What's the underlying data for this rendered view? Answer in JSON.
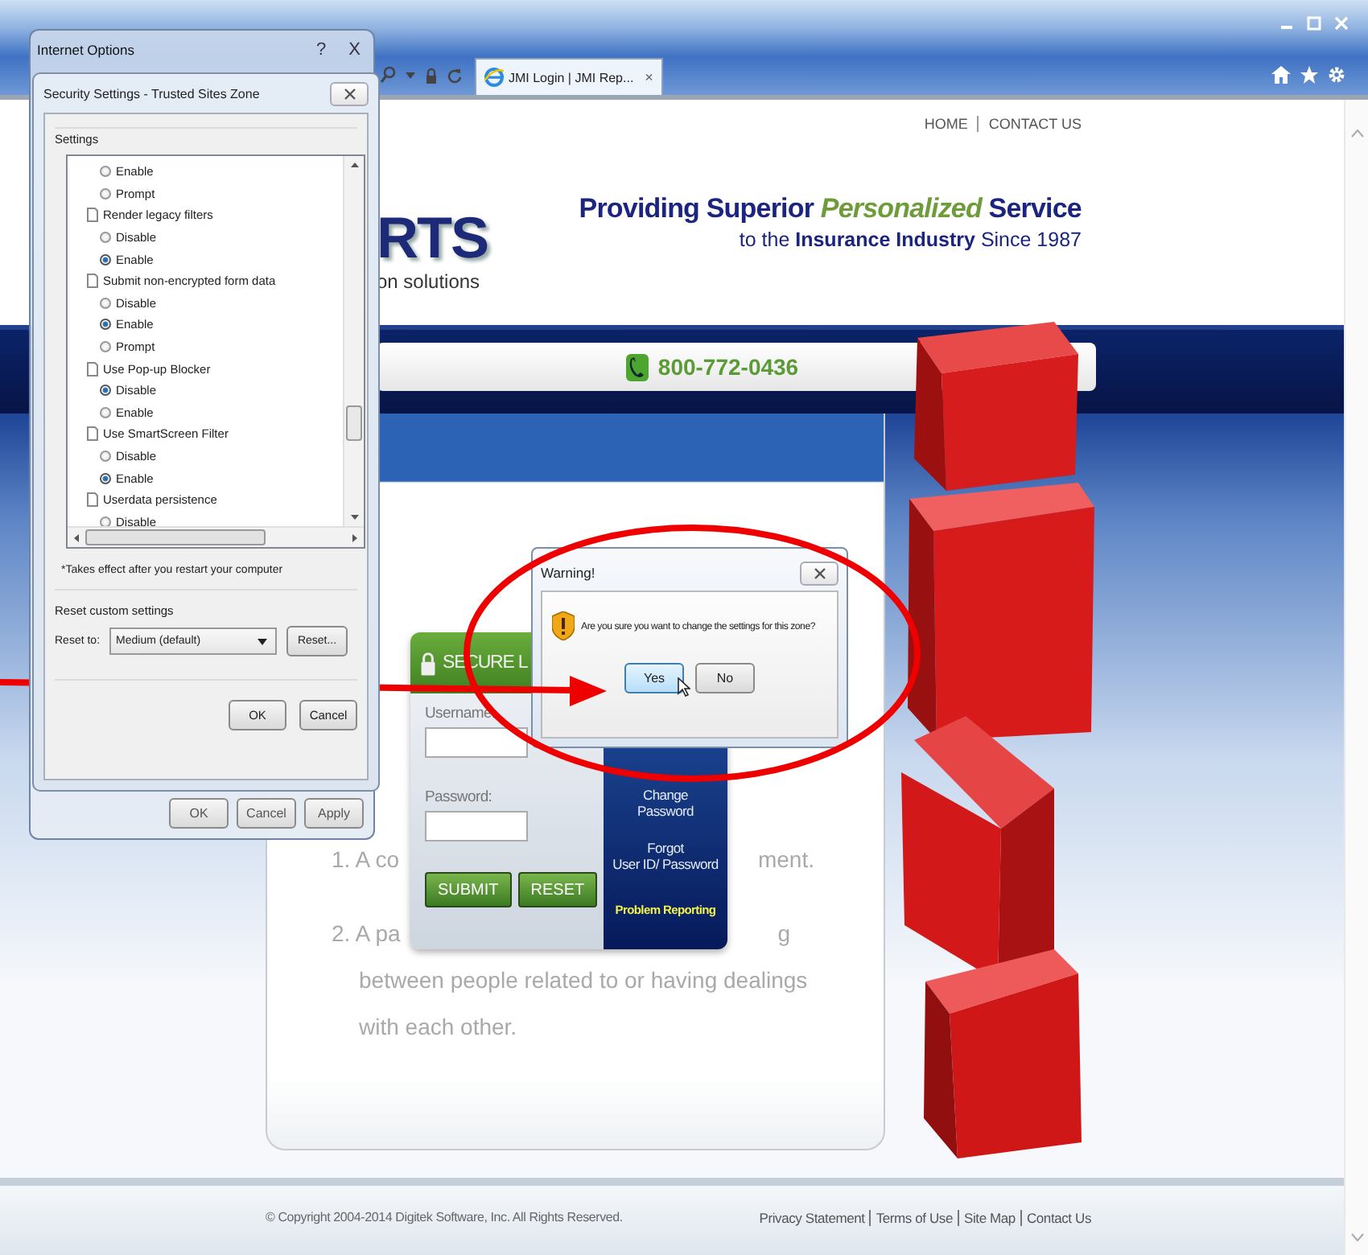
{
  "browser": {
    "tab": {
      "title": "JMI Login | JMI Rep...",
      "close": "×"
    }
  },
  "site": {
    "nav": [
      "HOME",
      "CONTACT US"
    ],
    "logo": [
      "RTS",
      "on solutions"
    ],
    "tagline": [
      "Providing Superior *Personalized* Service",
      "to the **Insurance Industry** Since 1987"
    ],
    "phone": "800-772-0436",
    "faded_text": [
      [
        "1. A co",
        "ment."
      ],
      [
        "2. A pa",
        "g"
      ],
      [
        "between people related to or having dealings"
      ],
      [
        "with each other."
      ]
    ],
    "login": {
      "header": "SECURE L",
      "username_label": "Username:",
      "password_label": "Password:",
      "buttons": [
        "SUBMIT",
        "RESET"
      ],
      "links": [
        {
          "lines": [
            "Change",
            "Password"
          ],
          "highlight": false
        },
        {
          "lines": [
            "Forgot",
            "User ID/ Password"
          ],
          "highlight": false
        },
        {
          "lines": [
            "Problem Reporting"
          ],
          "highlight": true
        }
      ]
    },
    "footer": {
      "copyright": "© Copyright 2004-2014 Digitek Software, Inc. All Rights Reserved.",
      "links": [
        "Privacy Statement",
        "Terms of Use",
        "Site Map",
        "Contact Us"
      ]
    }
  },
  "internet_options": {
    "title": "Internet Options",
    "help": "?",
    "close": "X",
    "buttons": [
      "OK",
      "Cancel",
      "Apply"
    ]
  },
  "security_settings": {
    "title": "Security Settings - Trusted Sites Zone",
    "settings_label": "Settings",
    "items": [
      {
        "kind": "option",
        "label": "Enable",
        "selected": false
      },
      {
        "kind": "option",
        "label": "Prompt",
        "selected": false
      },
      {
        "kind": "group",
        "label": "Render legacy filters"
      },
      {
        "kind": "option",
        "label": "Disable",
        "selected": false
      },
      {
        "kind": "option",
        "label": "Enable",
        "selected": true
      },
      {
        "kind": "group",
        "label": "Submit non-encrypted form data"
      },
      {
        "kind": "option",
        "label": "Disable",
        "selected": false
      },
      {
        "kind": "option",
        "label": "Enable",
        "selected": true
      },
      {
        "kind": "option",
        "label": "Prompt",
        "selected": false
      },
      {
        "kind": "group",
        "label": "Use Pop-up Blocker"
      },
      {
        "kind": "option",
        "label": "Disable",
        "selected": true
      },
      {
        "kind": "option",
        "label": "Enable",
        "selected": false
      },
      {
        "kind": "group",
        "label": "Use SmartScreen Filter"
      },
      {
        "kind": "option",
        "label": "Disable",
        "selected": false
      },
      {
        "kind": "option",
        "label": "Enable",
        "selected": true
      },
      {
        "kind": "group",
        "label": "Userdata persistence"
      },
      {
        "kind": "option",
        "label": "Disable",
        "selected": false
      }
    ],
    "note": "*Takes effect after you restart your computer",
    "reset_group": "Reset custom settings",
    "reset_to": "Reset to:",
    "reset_value": "Medium (default)",
    "reset_button": "Reset...",
    "buttons": [
      "OK",
      "Cancel"
    ]
  },
  "warning": {
    "title": "Warning!",
    "message": "Are you sure you want to change the settings for this zone?",
    "buttons": [
      {
        "label": "Yes",
        "focused": true
      },
      {
        "label": "No",
        "focused": false
      }
    ]
  }
}
